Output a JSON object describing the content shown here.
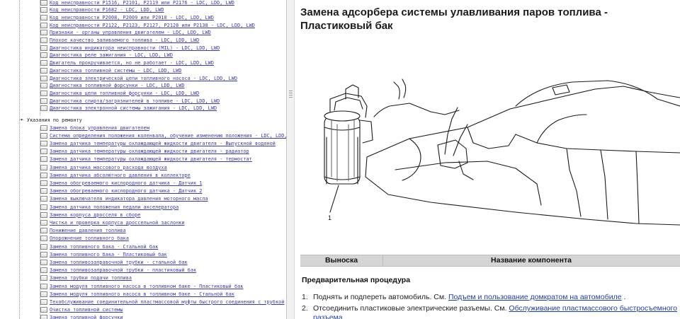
{
  "tree": {
    "group_top": [
      "Код неисправности P1516, P2101, P2119 или P2176 - LDC, LDD, LWD",
      "Код неисправности P1682 - LDC, LDD, LWD",
      "Код неисправности P2008, P2009 или P2010 - LDC, LDD, LWD",
      "Код неисправности P2122, P2123, P2127, P2128 или P2138 - LDC, LDD, LWD",
      "Признаки - органы управления двигателем - LDC, LDD, LWD",
      "Плохое качество заливаемого топлива - LDC, LDD, LWD",
      "Диагностика индикатора неисправности (MIL) - LDC, LDD, LWD",
      "Диагностика реле зажигания - LDC, LDD, LWD",
      "Двигатель прокручивается, но не работает - LDC, LDD, LWD",
      "Диагностика топливной системы - LDC, LDD, LWD",
      "Диагностика электрической цепи топливного насоса - LDC, LDD, LWD",
      "Диагностика топливной форсунки - LDC, LDD, LWD",
      "Диагностика цепи топливной форсунки - LDC, LDD, LWD",
      "Диагностика спирта/загрязнителей в топливе - LDC, LDD, LWD",
      "Диагностика электронной системы зажигания - LDC, LDD, LWD"
    ],
    "folder_label": "Указания по ремонту",
    "group_repair": [
      "Замена блока управления двигателем",
      "Система определения положения коленвала, обучение изменению положения - LDC, LDD, LWD",
      "Замена датчика температуры охлаждающей жидкости двигателя - Выпускной водяной",
      "Замена датчика температуры охлаждающей жидкости двигателя - радиатор",
      "Замена датчика температуры охлаждающей жидкости двигателя - термостат",
      "Замена датчика массового расхода воздуха",
      "Замена датчика абсолютного давления в коллекторе",
      "Замена обогреваемого кислородного датчика - Датчик 1",
      "Замена обогреваемого кислородного датчика - Датчик 2",
      "Замена выключателя индикатора давления моторного масла",
      "Замена датчика положения педали акселератора",
      "Замена корпуса дросселя в сборе",
      "Чистка и проверка корпуса дроссельной заслонки",
      "Понижение давления топлива",
      "Опорожнение топливного бака",
      "Замена топливного бака - Стальной бак",
      "Замена топливного бака - Пластиковый бак",
      "Замена топливозаправочной трубки - стальной бак",
      "Замена топливозаправочной трубки - пластиковый бак",
      "Замена трубки подачи топлива",
      "Замена модуля топливного насоса в топливном баке - Пластиковый бак",
      "Замена модуля топливного насоса в топливном баке - Стальной бак",
      "Техобслуживание соединительной пластмассовой муфты быстрого соединения с трубкой",
      "Очистка топливной системы",
      "Замена топливной форсунки"
    ]
  },
  "content": {
    "title": "Замена адсорбера системы улавливания паров топлива - Пластиковый бак",
    "callout_label": "1",
    "table": {
      "col_callout": "Выноска",
      "col_name": "Название компонента"
    },
    "procedure_title": "Предварительная процедура",
    "steps": [
      {
        "num": "1.",
        "text_before": "Поднять и подпереть автомобиль. См. ",
        "link": "Подъем и пользование домкратом на автомобиле",
        "text_after": " ."
      },
      {
        "num": "2.",
        "text_before": "Отсоединить пластиковые электрические разъемы. См. ",
        "link": "Обслуживание пластмассового быстросъемного разъема",
        "text_after": " ."
      }
    ]
  },
  "colors": {
    "link": "#1c3fb0",
    "tree_link": "#3a3aa8",
    "table_header_bg": "#d5d5d5"
  },
  "icons": {
    "tree_item": "document-node-icon",
    "tree_folder": "collapse-triangle-icon",
    "splitter": "splitter-grip-icon"
  }
}
